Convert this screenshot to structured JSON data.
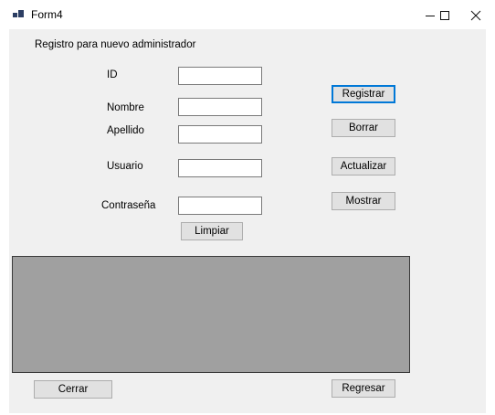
{
  "window": {
    "title": "Form4",
    "minimize_icon": "minimize-icon",
    "maximize_icon": "maximize-icon",
    "close_icon": "close-icon"
  },
  "form": {
    "heading": "Registro para nuevo administrador",
    "fields": {
      "id_label": "ID",
      "id_value": "",
      "nombre_label": "Nombre",
      "nombre_value": "",
      "apellido_label": "Apellido",
      "apellido_value": "",
      "usuario_label": "Usuario",
      "usuario_value": "",
      "contrasena_label": "Contraseña",
      "contrasena_value": ""
    },
    "buttons": {
      "registrar": "Registrar",
      "borrar": "Borrar",
      "actualizar": "Actualizar",
      "mostrar": "Mostrar",
      "limpiar": "Limpiar",
      "cerrar": "Cerrar",
      "regresar": "Regresar"
    }
  },
  "colors": {
    "client_background": "#f0f0f0",
    "grid_background": "#a0a0a0",
    "default_button_border": "#0078d7"
  }
}
